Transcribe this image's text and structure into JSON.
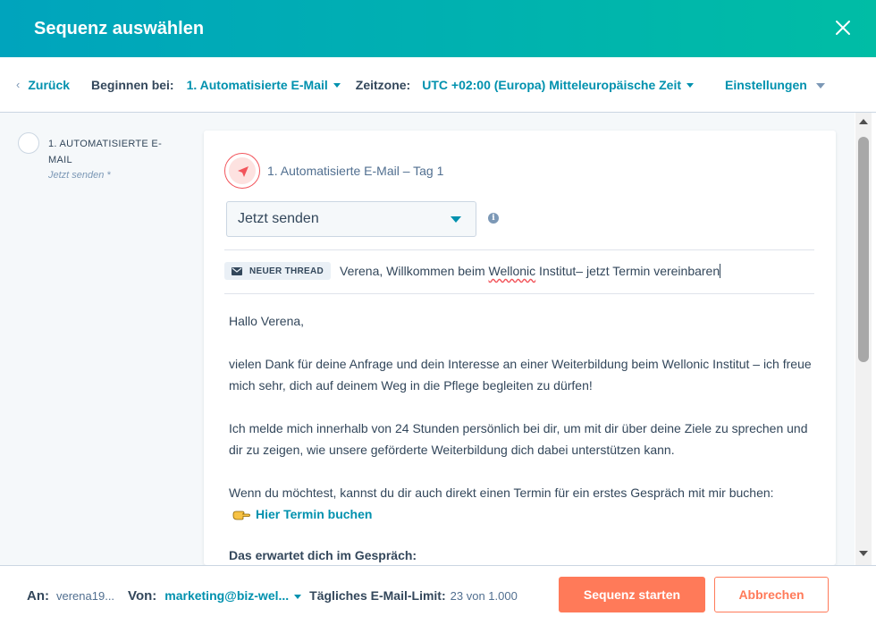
{
  "header": {
    "title": "Sequenz auswählen",
    "close_icon": "close-icon"
  },
  "toolbar": {
    "back_label": "Zurück",
    "start_label": "Beginnen bei:",
    "start_value": "1. Automatisierte E-Mail",
    "timezone_label": "Zeitzone:",
    "timezone_value": "UTC +02:00 (Europa) Mitteleuropäische Zeit",
    "settings_label": "Einstellungen"
  },
  "sidebar": {
    "steps": [
      {
        "title": "1. AUTOMATISIERTE E-MAIL",
        "subtitle": "Jetzt senden *"
      }
    ]
  },
  "email": {
    "header_label": "1. Automatisierte E-Mail – Tag 1",
    "send_option": "Jetzt senden",
    "thread_badge": "NEUER THREAD",
    "subject_before": "Verena, Willkommen beim ",
    "subject_spell": "Wellonic",
    "subject_after": " Institut– jetzt Termin vereinbaren",
    "greeting": "Hallo Verena,",
    "paragraph1": "vielen Dank für deine Anfrage und dein Interesse an einer Weiterbildung beim Wellonic Institut – ich freue mich sehr, dich auf deinem Weg in die Pflege begleiten zu dürfen!",
    "paragraph2": "Ich melde mich innerhalb von 24 Stunden persönlich bei dir, um mit dir über deine Ziele zu sprechen und dir zu zeigen, wie unsere geförderte Weiterbildung dich dabei unterstützen kann.",
    "paragraph3": "Wenn du möchtest, kannst du dir auch direkt einen Termin für ein erstes Gespräch mit mir buchen:",
    "link_text": "Hier Termin buchen",
    "heading": "Das erwartet dich im Gespräch:"
  },
  "footer": {
    "to_label": "An:",
    "to_value": "verena19...",
    "from_label": "Von:",
    "from_value": "marketing@biz-wel...",
    "limit_label": "Tägliches E-Mail-Limit:",
    "limit_value": "23 von 1.000",
    "start_button": "Sequenz starten",
    "cancel_button": "Abbrechen"
  },
  "colors": {
    "accent": "#0091ae",
    "header_gradient_start": "#00a4bd",
    "header_gradient_end": "#00bda5",
    "primary_button": "#ff7a59"
  }
}
